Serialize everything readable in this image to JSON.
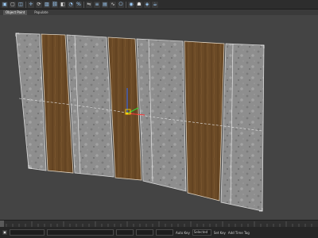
{
  "toolbar": {
    "buttons": [
      {
        "name": "select-icon",
        "glyph": "▣"
      },
      {
        "name": "select-region-icon",
        "glyph": "▢"
      },
      {
        "name": "select-window-icon",
        "glyph": "◫"
      },
      {
        "name": "move-icon",
        "glyph": "✛"
      },
      {
        "name": "rotate-icon",
        "glyph": "⟳"
      },
      {
        "name": "scale-icon",
        "glyph": "▨"
      },
      {
        "name": "link-icon",
        "glyph": "⛓"
      },
      {
        "name": "snap-icon",
        "glyph": "◧"
      },
      {
        "name": "angle-snap-icon",
        "glyph": "◔"
      },
      {
        "name": "percent-snap-icon",
        "glyph": "%"
      },
      {
        "name": "mirror-icon",
        "glyph": "⇋"
      },
      {
        "name": "align-icon",
        "glyph": "≡"
      },
      {
        "name": "layer-icon",
        "glyph": "▤"
      },
      {
        "name": "curve-editor-icon",
        "glyph": "∿"
      },
      {
        "name": "schematic-icon",
        "glyph": "⎔"
      },
      {
        "name": "material-editor-icon",
        "glyph": "◉"
      },
      {
        "name": "render-setup-icon",
        "glyph": "☗"
      },
      {
        "name": "render-icon",
        "glyph": "◈"
      },
      {
        "name": "teapot-icon",
        "glyph": "☕"
      }
    ]
  },
  "tabs": [
    {
      "label": "Object Paint",
      "active": true
    },
    {
      "label": "Populate",
      "active": false
    }
  ],
  "status": {
    "frame": "0",
    "auto_key": "Auto Key",
    "set_key": "Set Key",
    "selected": "Selected",
    "key_filters": "Add Time Tag"
  },
  "colors": {
    "wood": "#6b4a26",
    "stone": "#8d8d8d",
    "background": "#444444"
  }
}
